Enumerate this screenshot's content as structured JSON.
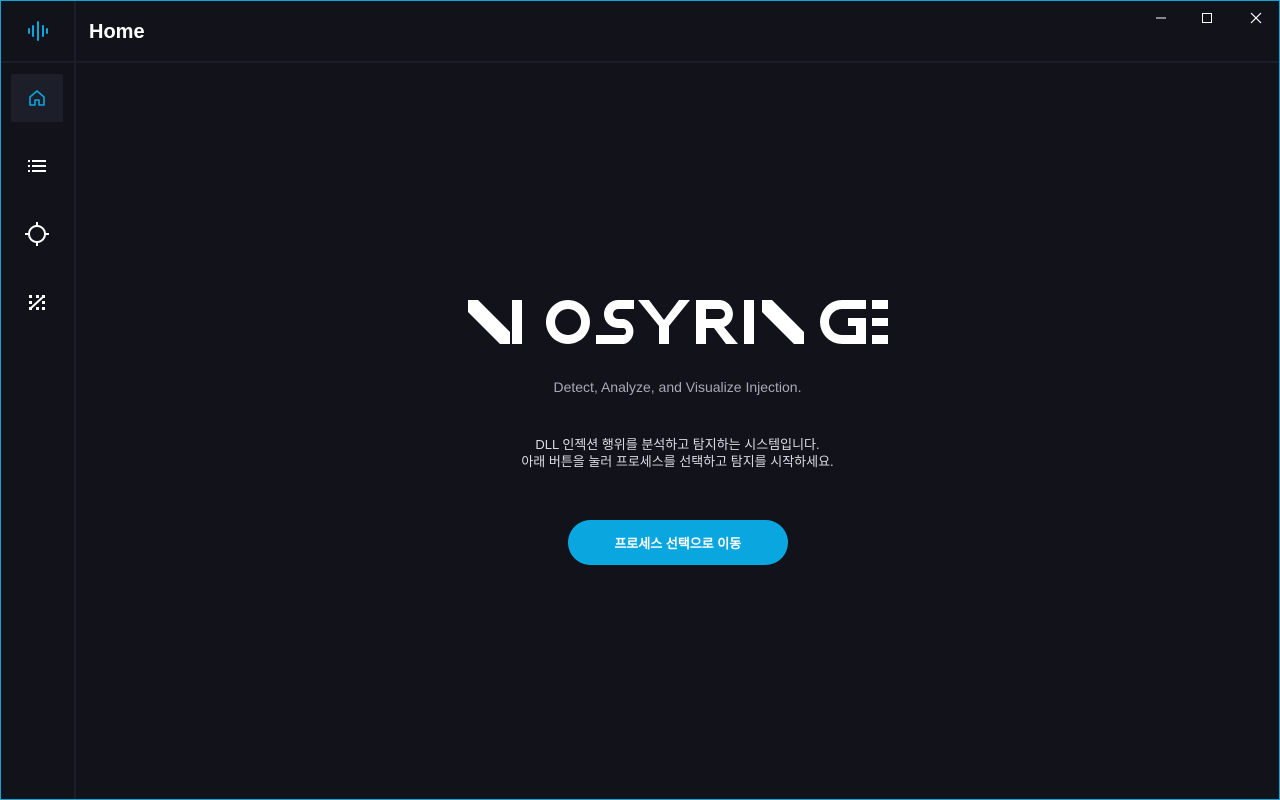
{
  "app": {
    "brand_name": "NO SYRINGE",
    "accent_color": "#0aa6df"
  },
  "header": {
    "title": "Home"
  },
  "window_controls": {
    "minimize_icon": "minimize-icon",
    "maximize_icon": "maximize-icon",
    "close_icon": "close-icon"
  },
  "sidebar": {
    "items": [
      {
        "icon": "home-icon",
        "active": true
      },
      {
        "icon": "list-icon",
        "active": false
      },
      {
        "icon": "crosshair-icon",
        "active": false
      },
      {
        "icon": "analysis-icon",
        "active": false
      }
    ]
  },
  "main": {
    "tagline": "Detect, Analyze, and Visualize Injection.",
    "description_line1": "DLL 인젝션 행위를 분석하고 탐지하는 시스템입니다.",
    "description_line2": "아래 버튼을 눌러 프로세스를 선택하고 탐지를 시작하세요.",
    "cta_label": "프로세스 선택으로 이동"
  }
}
